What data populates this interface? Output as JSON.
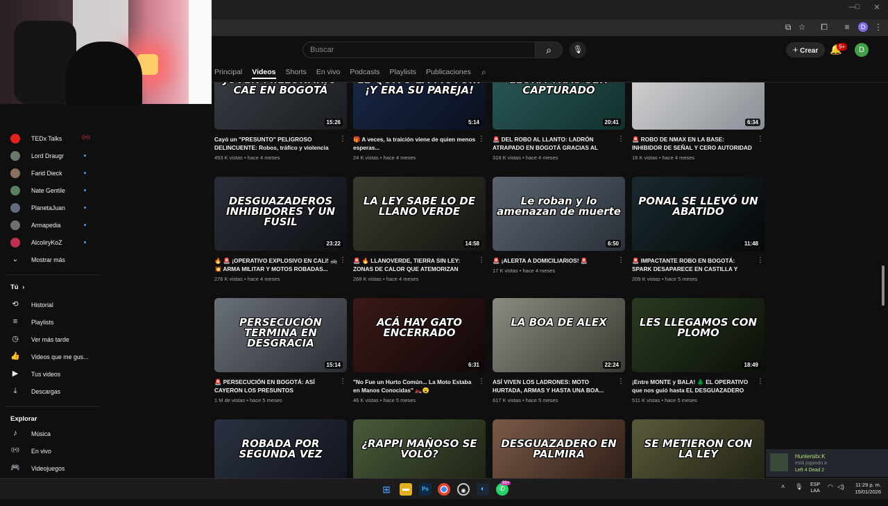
{
  "window": {
    "controls": [
      "—",
      "□",
      "✕"
    ]
  },
  "header": {
    "search_placeholder": "Buscar",
    "create_label": "Crear",
    "notif_badge": "9+",
    "avatar_letter": "D",
    "small_avatar_letter": "D"
  },
  "tabs": [
    {
      "label": "Principal"
    },
    {
      "label": "Videos"
    },
    {
      "label": "Shorts"
    },
    {
      "label": "En vivo"
    },
    {
      "label": "Podcasts"
    },
    {
      "label": "Playlists"
    },
    {
      "label": "Publicaciones"
    }
  ],
  "sidebar": {
    "subscriptions": [
      {
        "label": "TEDx Talks",
        "color": "#e62117"
      },
      {
        "label": "Lord Draugr",
        "color": "#6a7a6a"
      },
      {
        "label": "Farid Dieck",
        "color": "#8a7060"
      },
      {
        "label": "Nate Gentile",
        "color": "#5a8060"
      },
      {
        "label": "PlanetaJuan",
        "color": "#606a80"
      },
      {
        "label": "Armapedia",
        "color": "#707070"
      },
      {
        "label": "AlcoliryKoZ",
        "color": "#c03050"
      }
    ],
    "show_more": "Mostrar más",
    "you_title": "Tú",
    "you_items": [
      {
        "label": "Historial",
        "icon": "history-icon"
      },
      {
        "label": "Playlists",
        "icon": "playlists-icon"
      },
      {
        "label": "Ver más tarde",
        "icon": "watch-later-icon"
      },
      {
        "label": "Videos que me gus...",
        "icon": "like-icon"
      },
      {
        "label": "Tus videos",
        "icon": "your-videos-icon"
      },
      {
        "label": "Descargas",
        "icon": "downloads-icon"
      }
    ],
    "explore_title": "Explorar",
    "explore_items": [
      {
        "label": "Música",
        "icon": "music-icon"
      },
      {
        "label": "En vivo",
        "icon": "live-icon"
      },
      {
        "label": "Videojuegos",
        "icon": "gaming-icon"
      }
    ]
  },
  "videos": [
    {
      "caption": "JOVEN MILLONARIO CAE EN BOGOTÁ",
      "duration": "15:26",
      "title": "Cayó un \"PRESUNTO\" PELIGROSO DELINCUENTE: Robos, tráfico y violencia e...",
      "meta": "493 K vistas  •  hace 4 meses",
      "bg": "linear-gradient(135deg,#3a3f46,#1a1c20)"
    },
    {
      "caption": "LE QUITÓ LA MOTO... ¡Y ERA SU PAREJA!",
      "duration": "5:14",
      "title": "🎁 A veces, la traición viene de quien menos esperas...",
      "meta": "24 K vistas  •  hace 4 meses",
      "bg": "linear-gradient(135deg,#1a2a4a,#0a0f1e)"
    },
    {
      "caption": "LLORA TRAS SER CAPTURADO",
      "duration": "20:41",
      "title": "🚨 DEL ROBO AL LLANTO: LADRÓN ATRAPADO EN BOGOTÁ GRACIAS AL GPS...",
      "meta": "318 K vistas  •  hace 4 meses",
      "bg": "linear-gradient(135deg,#2a5a5a,#12302c)"
    },
    {
      "caption": "",
      "duration": "6:34",
      "title": "🚨 ROBO DE NMAX EN LA BASE: INHIBIDOR DE SEÑAL Y CERO AUTORIDAD 🚓 ❌",
      "meta": "16 K vistas  •  hace 4 meses",
      "bg": "linear-gradient(135deg,#d8d8d8,#8a8f96)"
    },
    {
      "caption": "DESGUAZADEROS INHIBIDORES Y UN FUSIL",
      "duration": "23:22",
      "title": "🔥 🚨 ¡OPERATIVO EXPLOSIVO EN CALI! 🚓 💥 ARMA MILITAR Y MOTOS ROBADAS...",
      "meta": "276 K vistas  •  hace 4 meses",
      "bg": "linear-gradient(135deg,#2a2e38,#0e1014)"
    },
    {
      "caption": "LA LEY SABE LO DE LLANO VERDE",
      "duration": "14:58",
      "title": "🚨 🔥 LLANOVERDE, TIERRA SIN LEY: ZONAS DE CALOR QUE ATEMORIZAN CALI...",
      "meta": "268 K vistas  •  hace 4 meses",
      "bg": "linear-gradient(135deg,#3a3a30,#151510)"
    },
    {
      "caption": "Le roban y lo amenazan de muerte",
      "duration": "6:50",
      "title": "🚨 ¡ALERTA A DOMICILIARIOS! 🚨",
      "meta": "17 K vistas  •  hace 4 meses",
      "bg": "linear-gradient(135deg,#5a6470,#2a3038)"
    },
    {
      "caption": "PONAL SE LLEVÓ UN ABATIDO",
      "duration": "11:48",
      "title": "🚨 IMPACTANTE ROBO EN BOGOTÁ: SPARK DESAPARECE EN CASTILLA Y APARECE E...",
      "meta": "209 K vistas  •  hace 5 meses",
      "bg": "linear-gradient(135deg,#1a2a30,#050808)"
    },
    {
      "caption": "PERSECUCIÓN TERMINA EN DESGRACIA",
      "duration": "15:14",
      "title": "🚨 PERSECUCIÓN EN BOGOTÁ: ASÍ CAYERON LOS PRESUNTOS DELINCUENTE...",
      "meta": "1 M de vistas  •  hace 5 meses",
      "bg": "linear-gradient(135deg,#6a7078,#2a2e34)"
    },
    {
      "caption": "ACÁ HAY GATO ENCERRADO",
      "duration": "6:31",
      "title": "\"No Fue un Hurto Común... La Moto Estaba en Manos Conocidas\" 🏍️😮",
      "meta": "46 K vistas  •  hace 5 meses",
      "bg": "linear-gradient(135deg,#3a1818,#120808)"
    },
    {
      "caption": "LA BOA DE ALEX",
      "duration": "22:24",
      "title": "ASÍ VIVEN LOS LADRONES: MOTO HURTADA, ARMAS Y HASTA UNA BOA...",
      "meta": "617 K vistas  •  hace 5 meses",
      "bg": "linear-gradient(135deg,#8a8a80,#3a3a34)"
    },
    {
      "caption": "LES LLEGAMOS CON PLOMO",
      "duration": "18:49",
      "title": "¡Entre MONTE y BALA! 🌲 EL OPERATIVO que nos guió hasta EL DESGUAZADERO",
      "meta": "511 K vistas  •  hace 5 meses",
      "bg": "linear-gradient(135deg,#2a3a20,#0a1008)"
    },
    {
      "caption": "ROBADA POR SEGUNDA VEZ",
      "duration": "",
      "title": "",
      "meta": "",
      "bg": "linear-gradient(135deg,#2a3040,#10141c)"
    },
    {
      "caption": "¿RAPPI MAÑOSO SE VOLÓ?",
      "duration": "",
      "title": "",
      "meta": "",
      "bg": "linear-gradient(135deg,#4a5a3a,#1a2012)"
    },
    {
      "caption": "DESGUAZADERO EN PALMIRA",
      "duration": "",
      "title": "",
      "meta": "",
      "bg": "linear-gradient(135deg,#7a5a48,#2a1a14)"
    },
    {
      "caption": "SE METIERON CON LA LEY",
      "duration": "",
      "title": "",
      "meta": "",
      "bg": "linear-gradient(135deg,#5a5a3a,#1e1e12)"
    }
  ],
  "toast": {
    "name": "Huntersitx:K",
    "status": "está jugando a",
    "game": "Left 4 Dead 2"
  },
  "taskbar": {
    "lang_top": "ESP",
    "lang_bottom": "LAA",
    "time": "11:29 p. m.",
    "date": "15/01/2026",
    "whatsapp_badge": "99+"
  }
}
